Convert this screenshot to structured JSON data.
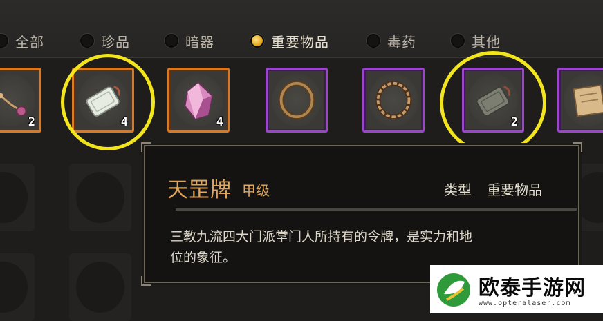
{
  "tabs": [
    {
      "label": "全部",
      "selected": false
    },
    {
      "label": "珍品",
      "selected": false
    },
    {
      "label": "暗器",
      "selected": false
    },
    {
      "label": "重要物品",
      "selected": true
    },
    {
      "label": "毒药",
      "selected": false
    },
    {
      "label": "其他",
      "selected": false
    }
  ],
  "items": [
    {
      "icon": "pendant-icon",
      "rarity": "orange",
      "qty": "2"
    },
    {
      "icon": "jade-token-icon",
      "rarity": "orange",
      "qty": "4",
      "highlighted": true
    },
    {
      "icon": "pink-crystal-icon",
      "rarity": "orange",
      "qty": "4"
    },
    {
      "icon": "bronze-ring-icon",
      "rarity": "purple",
      "qty": ""
    },
    {
      "icon": "rope-ring-icon",
      "rarity": "purple",
      "qty": ""
    },
    {
      "icon": "stone-token-icon",
      "rarity": "purple",
      "qty": "2",
      "highlighted": true
    },
    {
      "icon": "scroll-icon",
      "rarity": "purple",
      "qty": ""
    }
  ],
  "tooltip": {
    "title": "天罡牌",
    "grade": "甲级",
    "type_label": "类型",
    "type_value": "重要物品",
    "description_line1": "三教九流四大门派掌门人所持有的令牌，是实力和地",
    "description_line2": "位的象征。"
  },
  "watermark": {
    "brand": "欧泰手游网",
    "url": "www.opteralaser.com"
  },
  "colors": {
    "highlight": "#f2e51e",
    "rarity_orange": "#d97a22",
    "rarity_purple": "#9a46c9",
    "title_gold": "#e0a45a"
  }
}
